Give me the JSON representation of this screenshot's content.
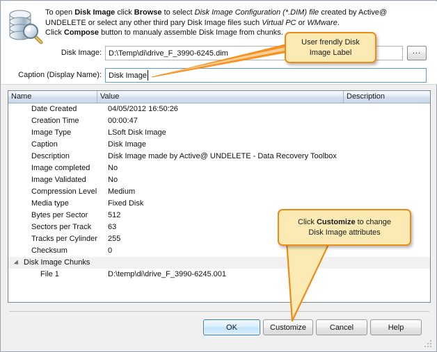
{
  "intro": {
    "line1_a": "To open ",
    "line1_b": "Disk Image",
    "line1_c": " click ",
    "line1_d": "Browse",
    "line1_e": " to select ",
    "line1_f": "Disk Image Configuration (*.DIM) file",
    "line1_g": " created by Active@",
    "line2_a": "UNDELETE or select any other third pary Disk Image files such ",
    "line2_b": "Virtual PC",
    "line2_c": " or ",
    "line2_d": "WMware",
    "line2_e": ".",
    "line3_a": "Click ",
    "line3_b": "Compose",
    "line3_c": " button to manualy assemble Disk Image from chunks."
  },
  "form": {
    "disk_image_label": "Disk Image:",
    "disk_image_value": "D:\\Temp\\di\\drive_F_3990-6245.dim",
    "disk_image_placeholder": "",
    "caption_label": "Caption (Display Name):",
    "caption_value": "Disk Image",
    "caption_placeholder": "",
    "browse_label": "..."
  },
  "grid": {
    "columns": [
      "Name",
      "Value",
      "Description"
    ],
    "rows": [
      {
        "name": "Date Created",
        "value": "04/05/2012 16:50:26",
        "style": "normal"
      },
      {
        "name": "Creation Time",
        "value": "00:00:47",
        "style": "normal"
      },
      {
        "name": "Image Type",
        "value": "LSoft Disk Image",
        "style": "normal"
      },
      {
        "name": "Caption",
        "value": "Disk Image",
        "style": "normal"
      },
      {
        "name": "Description",
        "value": "Disk Image made by Active@ UNDELETE - Data Recovery Toolbox",
        "style": "normal"
      },
      {
        "name": "Image completed",
        "value": "No",
        "style": "orange"
      },
      {
        "name": "Image Validated",
        "value": "No",
        "style": "normal"
      },
      {
        "name": "Compression Level",
        "value": "Medium",
        "style": "normal"
      },
      {
        "name": "Media type",
        "value": "Fixed Disk",
        "style": "normal"
      },
      {
        "name": "Bytes per Sector",
        "value": "512",
        "style": "normal"
      },
      {
        "name": "Sectors per Track",
        "value": "63",
        "style": "normal"
      },
      {
        "name": "Tracks per Cylinder",
        "value": "255",
        "style": "normal"
      },
      {
        "name": "Checksum",
        "value": "0",
        "style": "normal"
      }
    ],
    "group_row": {
      "name": "Disk Image Chunks",
      "value": ""
    },
    "child_row": {
      "name": "File 1",
      "value": "D:\\temp\\di\\drive_F_3990-6245.001",
      "style": "green"
    }
  },
  "buttons": {
    "ok": "OK",
    "customize": "Customize",
    "cancel": "Cancel",
    "help": "Help"
  },
  "callouts": {
    "caption_line1": "User frendly Disk",
    "caption_line2": "Image Label",
    "customize_a": "Click ",
    "customize_b": "Customize",
    "customize_c": " to change",
    "customize_d": "Disk Image attributes"
  },
  "colors": {
    "callout_fill": "#fbeab4",
    "callout_border": "#ec8b16",
    "value_orange": "#e08a1e",
    "value_green": "#168a16",
    "focus_border": "#5a9ddb"
  }
}
